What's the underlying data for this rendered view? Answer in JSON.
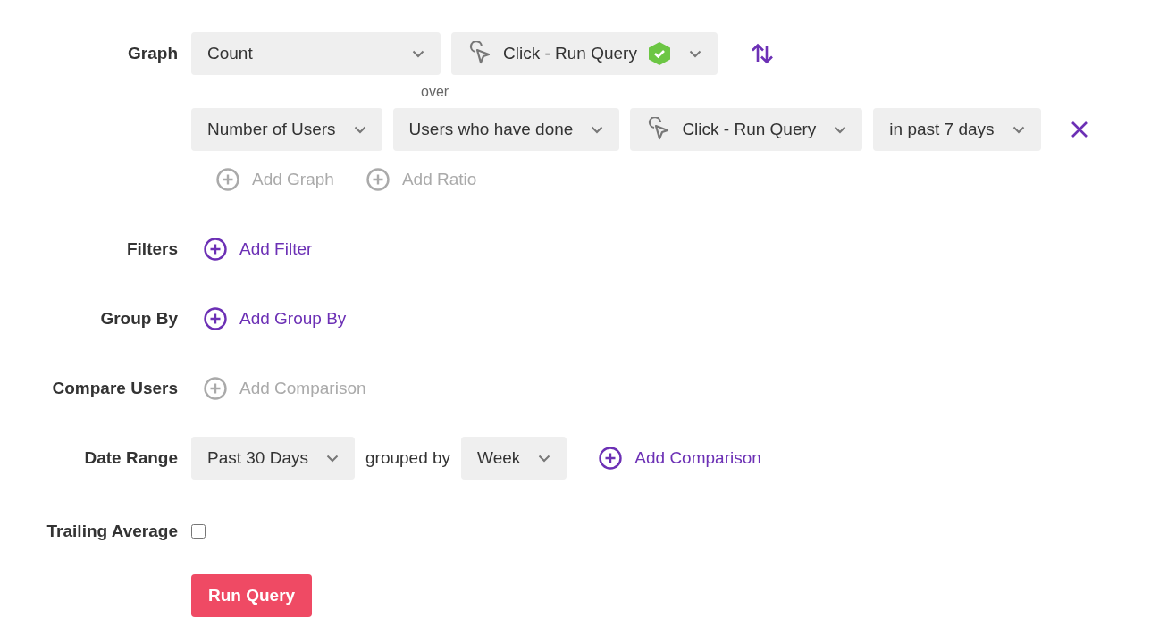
{
  "graph": {
    "label": "Graph",
    "metric": {
      "value": "Count"
    },
    "event": {
      "value": "Click - Run Query",
      "verified": true
    },
    "over": "over",
    "segments": [
      {
        "kind": "select",
        "value": "Number of Users"
      },
      {
        "kind": "select",
        "value": "Users who have done"
      },
      {
        "kind": "event",
        "value": "Click - Run Query"
      },
      {
        "kind": "select",
        "value": "in past 7 days"
      }
    ],
    "actions": [
      {
        "label": "Add Graph",
        "disabled": true
      },
      {
        "label": "Add Ratio",
        "disabled": true
      }
    ]
  },
  "rows": [
    {
      "label": "Filters",
      "action": {
        "label": "Add Filter",
        "disabled": false
      }
    },
    {
      "label": "Group By",
      "action": {
        "label": "Add Group By",
        "disabled": false
      }
    },
    {
      "label": "Compare Users",
      "action": {
        "label": "Add Comparison",
        "disabled": true
      }
    }
  ],
  "date_range": {
    "label": "Date Range",
    "range": "Past 30 Days",
    "grouped_by": "grouped by",
    "interval": "Week",
    "action": {
      "label": "Add Comparison",
      "disabled": false
    }
  },
  "trailing_average": {
    "label": "Trailing Average",
    "checked": false
  },
  "run_button": "Run Query"
}
